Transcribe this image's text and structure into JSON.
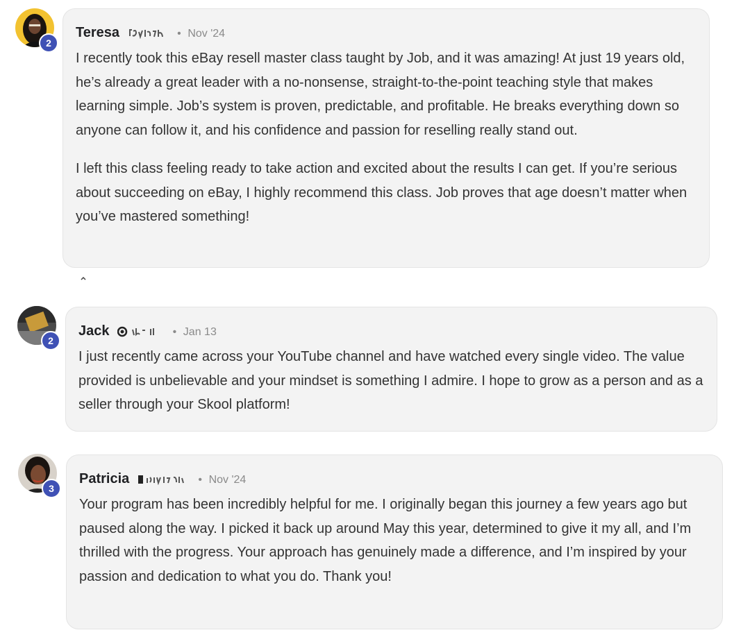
{
  "comments": [
    {
      "author": "Teresa",
      "separator": "•",
      "date": "Nov '24",
      "level": "2",
      "paragraphs": [
        "I recently took this eBay resell master class taught by Job, and it was amazing! At just 19 years old, he’s already a great leader with a no-nonsense, straight-to-the-point teaching style that makes learning simple. Job’s system is proven, predictable, and profitable. He breaks everything down so anyone can follow it, and his confidence and passion for reselling really stand out.",
        "I left this class feeling ready to take action and excited about the results I can get. If you’re serious about succeeding on eBay, I highly recommend this class. Job proves that age doesn’t matter when you’ve mastered something!"
      ]
    },
    {
      "author": "Jack",
      "separator": "•",
      "date": "Jan 13",
      "level": "2",
      "paragraphs": [
        "I just recently came across your YouTube channel and have watched every single video. The value provided is unbelievable and your mindset is something I admire. I hope to grow as a person and as a seller through your Skool platform!"
      ]
    },
    {
      "author": "Patricia",
      "separator": "•",
      "date": "Nov '24",
      "level": "3",
      "paragraphs": [
        "Your program has been incredibly helpful for me. I originally began this journey a few years ago but paused along the way. I picked it back up around May this year, determined to give it my all, and I’m thrilled with the progress. Your approach has genuinely made a difference, and I’m inspired by your passion and dedication to what you do. Thank you!"
      ]
    }
  ],
  "colors": {
    "bubble_bg": "#f3f3f3",
    "badge_bg": "#3f51b5",
    "meta_text": "#8a8a8a"
  },
  "icons": {
    "avatar_placeholder": "user-avatar-icon",
    "level_badge": "level-badge-icon"
  }
}
